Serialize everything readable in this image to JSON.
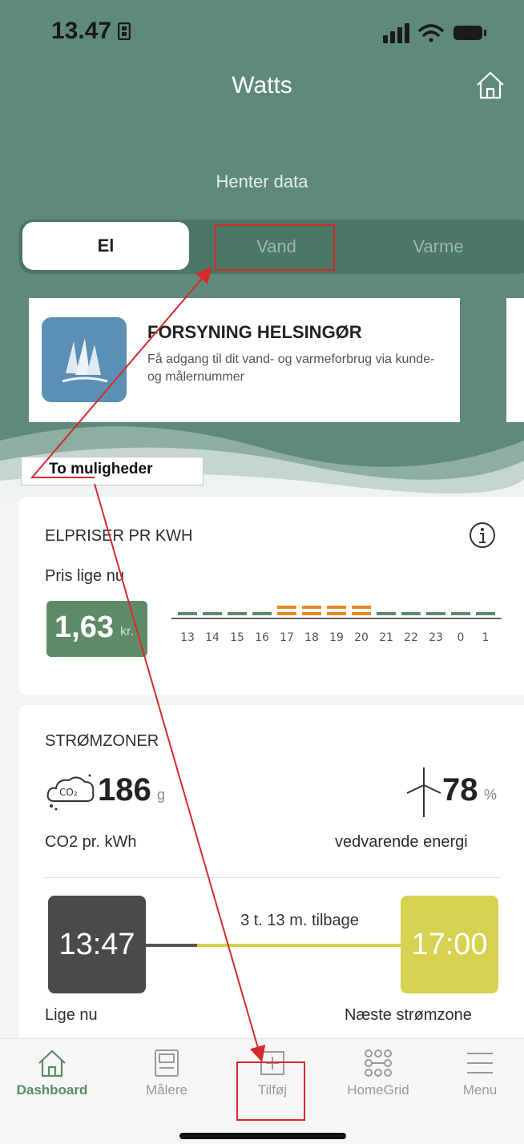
{
  "status_bar": {
    "time": "13.47"
  },
  "header": {
    "title": "Watts",
    "loading_text": "Henter data"
  },
  "tabs": [
    {
      "label": "El",
      "active": true
    },
    {
      "label": "Vand",
      "active": false
    },
    {
      "label": "Varme",
      "active": false
    }
  ],
  "promo": {
    "title": "FORSYNING HELSINGØR",
    "text": "Få adgang til dit vand- og varmeforbrug via kunde- og målernummer"
  },
  "tag": {
    "label": "To muligheder"
  },
  "prices": {
    "title": "ELPRISER PR KWH",
    "subtitle": "Pris lige nu",
    "value": "1,63",
    "unit": "kr.",
    "hours": [
      "13",
      "14",
      "15",
      "16",
      "17",
      "18",
      "19",
      "20",
      "21",
      "22",
      "23",
      "0",
      "1"
    ],
    "levels": [
      "low",
      "low",
      "low",
      "low",
      "high",
      "high",
      "high",
      "high",
      "low",
      "low",
      "low",
      "low",
      "low"
    ]
  },
  "zones": {
    "title": "STRØMZONER",
    "co2_value": "186",
    "co2_unit": "g",
    "co2_label": "CO2 pr. kWh",
    "renew_value": "78",
    "renew_unit": "%",
    "renew_label": "vedvarende energi",
    "now_time": "13:47",
    "next_time": "17:00",
    "gap_label": "3 t. 13 m. tilbage",
    "now_label": "Lige nu",
    "next_label": "Næste strømzone"
  },
  "nav": [
    {
      "label": "Dashboard",
      "icon": "home-icon",
      "active": true
    },
    {
      "label": "Målere",
      "icon": "meter-icon",
      "active": false
    },
    {
      "label": "Tilføj",
      "icon": "plus-icon",
      "active": false
    },
    {
      "label": "HomeGrid",
      "icon": "grid-icon",
      "active": false
    },
    {
      "label": "Menu",
      "icon": "menu-icon",
      "active": false
    }
  ],
  "colors": {
    "brand_green": "#5f8a7a",
    "price_low": "#5e8a67",
    "price_high": "#e58a1f",
    "next_zone": "#d6d24f",
    "annotation": "#d62a2a"
  }
}
